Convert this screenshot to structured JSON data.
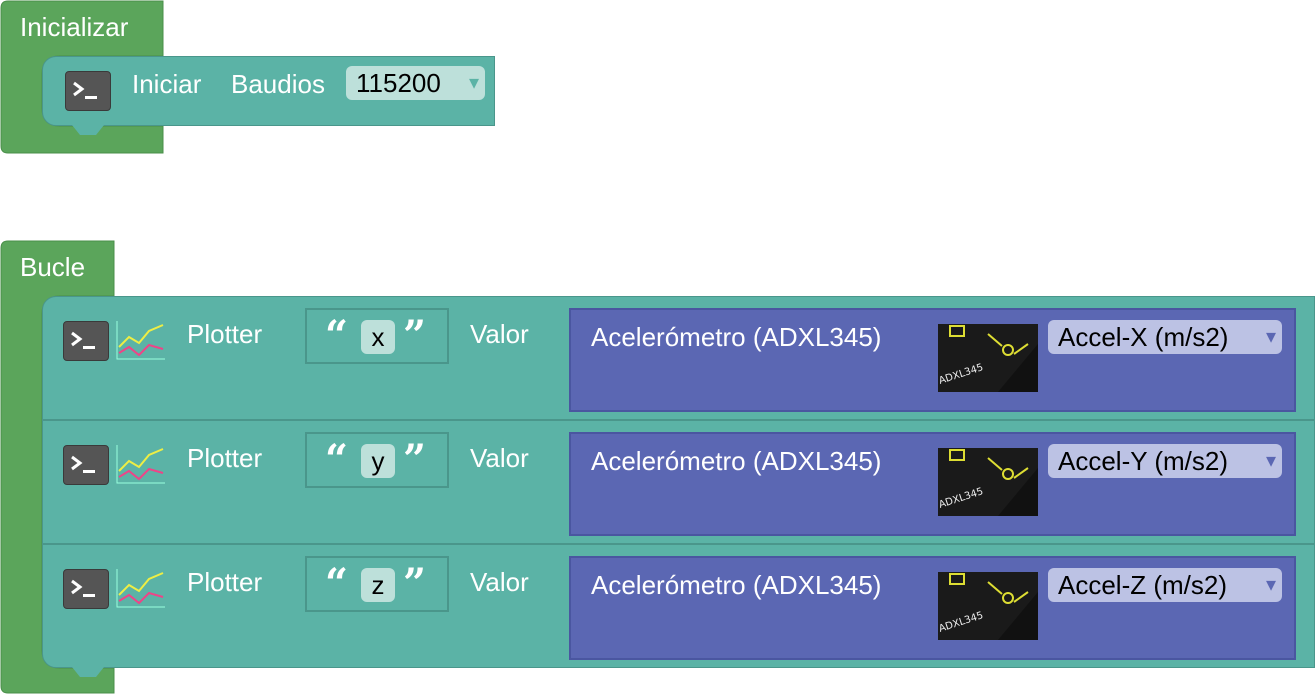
{
  "setup": {
    "header": "Inicializar",
    "block": {
      "label_iniciar": "Iniciar",
      "label_baudios": "Baudios",
      "baud_value": "115200"
    }
  },
  "loop": {
    "header": "Bucle",
    "rows": [
      {
        "plotter_label": "Plotter",
        "string_value": "x",
        "valor_label": "Valor",
        "sensor_label": "Acelerómetro (ADXL345)",
        "axis_value": "Accel-X (m/s2)",
        "sensor_img_text": "ADXL345"
      },
      {
        "plotter_label": "Plotter",
        "string_value": "y",
        "valor_label": "Valor",
        "sensor_label": "Acelerómetro (ADXL345)",
        "axis_value": "Accel-Y (m/s2)",
        "sensor_img_text": "ADXL345"
      },
      {
        "plotter_label": "Plotter",
        "string_value": "z",
        "valor_label": "Valor",
        "sensor_label": "Acelerómetro (ADXL345)",
        "axis_value": "Accel-Z (m/s2)",
        "sensor_img_text": "ADXL345"
      }
    ]
  },
  "icons": {
    "terminal": "terminal-icon",
    "plot": "line-chart-icon",
    "caret": "▾",
    "open_quote": "“",
    "close_quote": "”"
  },
  "colors": {
    "event_green": "#5ba55b",
    "serial_teal": "#5bb3a6",
    "sensor_blue": "#5b67b3"
  }
}
